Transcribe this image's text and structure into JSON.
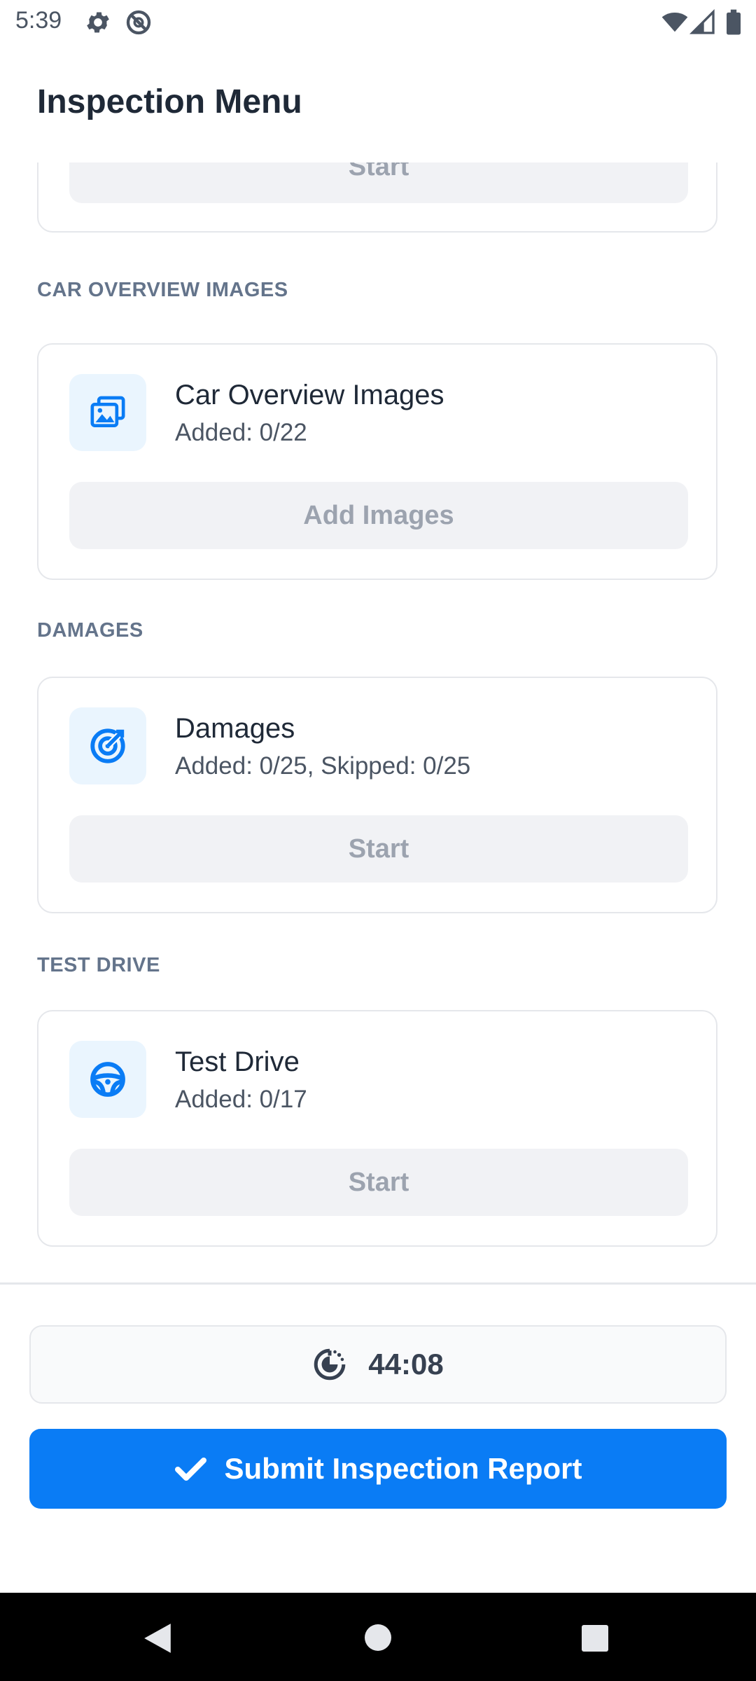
{
  "status_bar": {
    "time": "5:39",
    "icons": [
      "gear-icon",
      "do-not-disturb-icon",
      "wifi-icon",
      "signal-icon",
      "battery-icon"
    ]
  },
  "header": {
    "title": "Inspection Menu"
  },
  "partial_card": {
    "button_label": "Start"
  },
  "sections": [
    {
      "label": "CAR OVERVIEW IMAGES",
      "card_title": "Car Overview Images",
      "card_subtitle": "Added: 0/22",
      "button_label": "Add Images",
      "icon": "images-icon"
    },
    {
      "label": "DAMAGES",
      "card_title": "Damages",
      "card_subtitle": "Added: 0/25, Skipped: 0/25",
      "button_label": "Start",
      "icon": "target-icon"
    },
    {
      "label": "TEST DRIVE",
      "card_title": "Test Drive",
      "card_subtitle": "Added: 0/17",
      "button_label": "Start",
      "icon": "steering-wheel-icon"
    }
  ],
  "timer": {
    "value": "44:08",
    "icon": "timer-icon"
  },
  "submit": {
    "label": "Submit Inspection Report",
    "icon": "check-icon"
  },
  "colors": {
    "accent": "#0a7cf5",
    "icon_tile_bg": "#eaf5fe",
    "disabled_button_bg": "#f1f2f5",
    "disabled_button_text": "#9ca3af",
    "section_label": "#64748b"
  },
  "nav_bar": {
    "icons": [
      "back-icon",
      "home-icon",
      "recents-icon"
    ]
  }
}
